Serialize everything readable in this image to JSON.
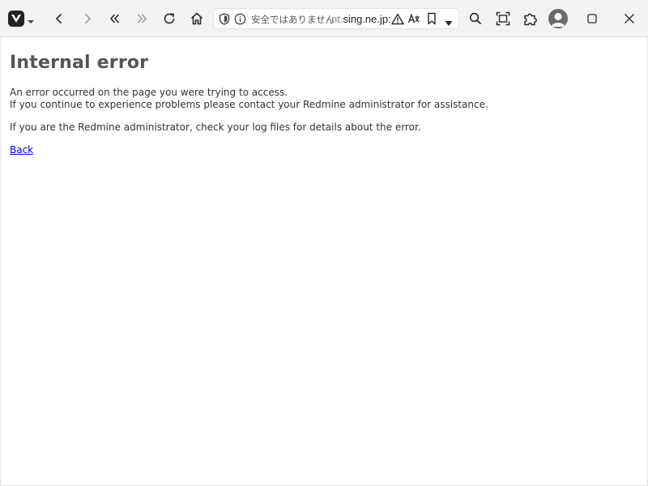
{
  "browser": {
    "address_bar": {
      "security_label": "安全ではありません",
      "url_prefix": "nt.",
      "url_main": "sing.ne.jp:"
    },
    "icons": {
      "logo": "vivaldi-logo-icon",
      "menu": "chevron-down-icon",
      "back": "chevron-left-icon",
      "forward": "chevron-right-icon",
      "rewind": "double-chevron-left-icon",
      "fast_forward": "double-chevron-right-icon",
      "reload": "reload-icon",
      "home": "home-icon",
      "shield": "shield-icon",
      "info": "info-icon",
      "warning": "warning-icon",
      "translate": "translate-icon",
      "bookmark": "bookmark-icon",
      "dropdown": "triangle-down-icon",
      "search": "search-icon",
      "capture": "capture-icon",
      "extensions": "puzzle-icon",
      "profile": "avatar",
      "maximize": "maximize-icon",
      "close": "close-icon"
    }
  },
  "page": {
    "title": "Internal error",
    "line1": "An error occurred on the page you were trying to access.",
    "line2": "If you continue to experience problems please contact your Redmine administrator for assistance.",
    "line3": "If you are the Redmine administrator, check your log files for details about the error.",
    "back_link": "Back"
  },
  "colors": {
    "heading": "#555555",
    "text": "#333333",
    "link": "#0000ee"
  }
}
